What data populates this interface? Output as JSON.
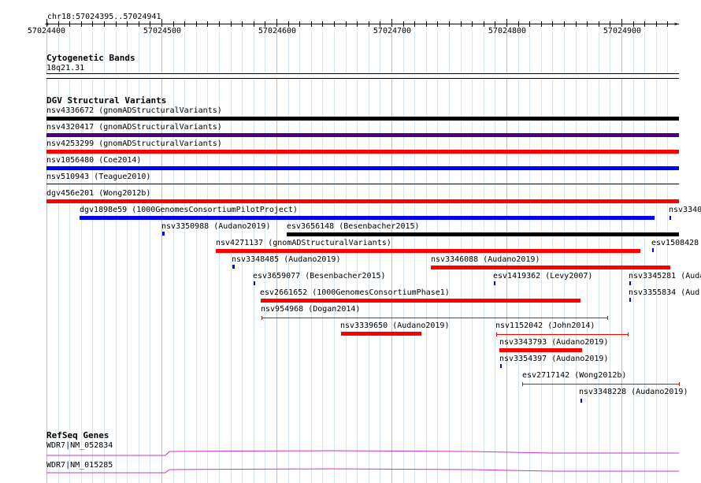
{
  "ruler": {
    "location": "chr18:57024395..57024941",
    "ticks": [
      "57024400",
      "57024500",
      "57024600",
      "57024700",
      "57024800",
      "57024900"
    ]
  },
  "tracks": {
    "cytoband": {
      "title": "Cytogenetic Bands",
      "band": "18q21.31"
    },
    "dgv": {
      "title": "DGV Structural Variants",
      "features": [
        {
          "label": "nsv4336672 (gnomADStructuralVariants)",
          "color": "#000000"
        },
        {
          "label": "nsv4320417 (gnomADStructuralVariants)",
          "color": "#4b0082"
        },
        {
          "label": "nsv4253299 (gnomADStructuralVariants)",
          "color": "#ff0000"
        },
        {
          "label": "nsv1056480 (Coe2014)",
          "color": "#0000ff"
        },
        {
          "label": "nsv510943 (Teague2010)",
          "color": "#000000"
        },
        {
          "label": "dgv456e201 (Wong2012b)",
          "color": "#ff0000"
        },
        {
          "label": "dgv1898e59 (1000GenomesConsortiumPilotProject)",
          "color": "#0000ff"
        },
        {
          "label": "nsv3340",
          "color": "#0000ff"
        },
        {
          "label": "nsv3350988 (Audano2019)",
          "color": "#0000ff"
        },
        {
          "label": "esv3656148 (Besenbacher2015)",
          "color": "#000000"
        },
        {
          "label": "nsv4271137 (gnomADStructuralVariants)",
          "color": "#ff0000"
        },
        {
          "label": "esv1508428",
          "color": "#0000ff"
        },
        {
          "label": "nsv3348485 (Audano2019)",
          "color": "#0000ff"
        },
        {
          "label": "nsv3346088 (Audano2019)",
          "color": "#ff0000"
        },
        {
          "label": "esv3659077 (Besenbacher2015)",
          "color": "#0000ff"
        },
        {
          "label": "esv1419362 (Levy2007)",
          "color": "#0000ff"
        },
        {
          "label": "nsv3345281 (Auda",
          "color": "#0000ff"
        },
        {
          "label": "esv2661652 (1000GenomesConsortiumPhase1)",
          "color": "#ff0000"
        },
        {
          "label": "nsv3355834 (Aud",
          "color": "#0000ff"
        },
        {
          "label": "nsv954968 (Dogan2014)",
          "color": "#ff0000"
        },
        {
          "label": "nsv3339650 (Audano2019)",
          "color": "#ff0000"
        },
        {
          "label": "nsv1152042 (John2014)",
          "color": "#ff0000"
        },
        {
          "label": "nsv3343793 (Audano2019)",
          "color": "#ff0000"
        },
        {
          "label": "nsv3354397 (Audano2019)",
          "color": "#0000ff"
        },
        {
          "label": "esv2717142 (Wong2012b)",
          "color": "#ff0000"
        },
        {
          "label": "nsv3348228 (Audano2019)",
          "color": "#0000ff"
        }
      ]
    },
    "refseq": {
      "title": "RefSeq Genes",
      "genes": [
        {
          "label": "WDR7|NM_052834",
          "color": "#cc33cc"
        },
        {
          "label": "WDR7|NM_015285",
          "color": "#cc33cc"
        }
      ]
    }
  }
}
